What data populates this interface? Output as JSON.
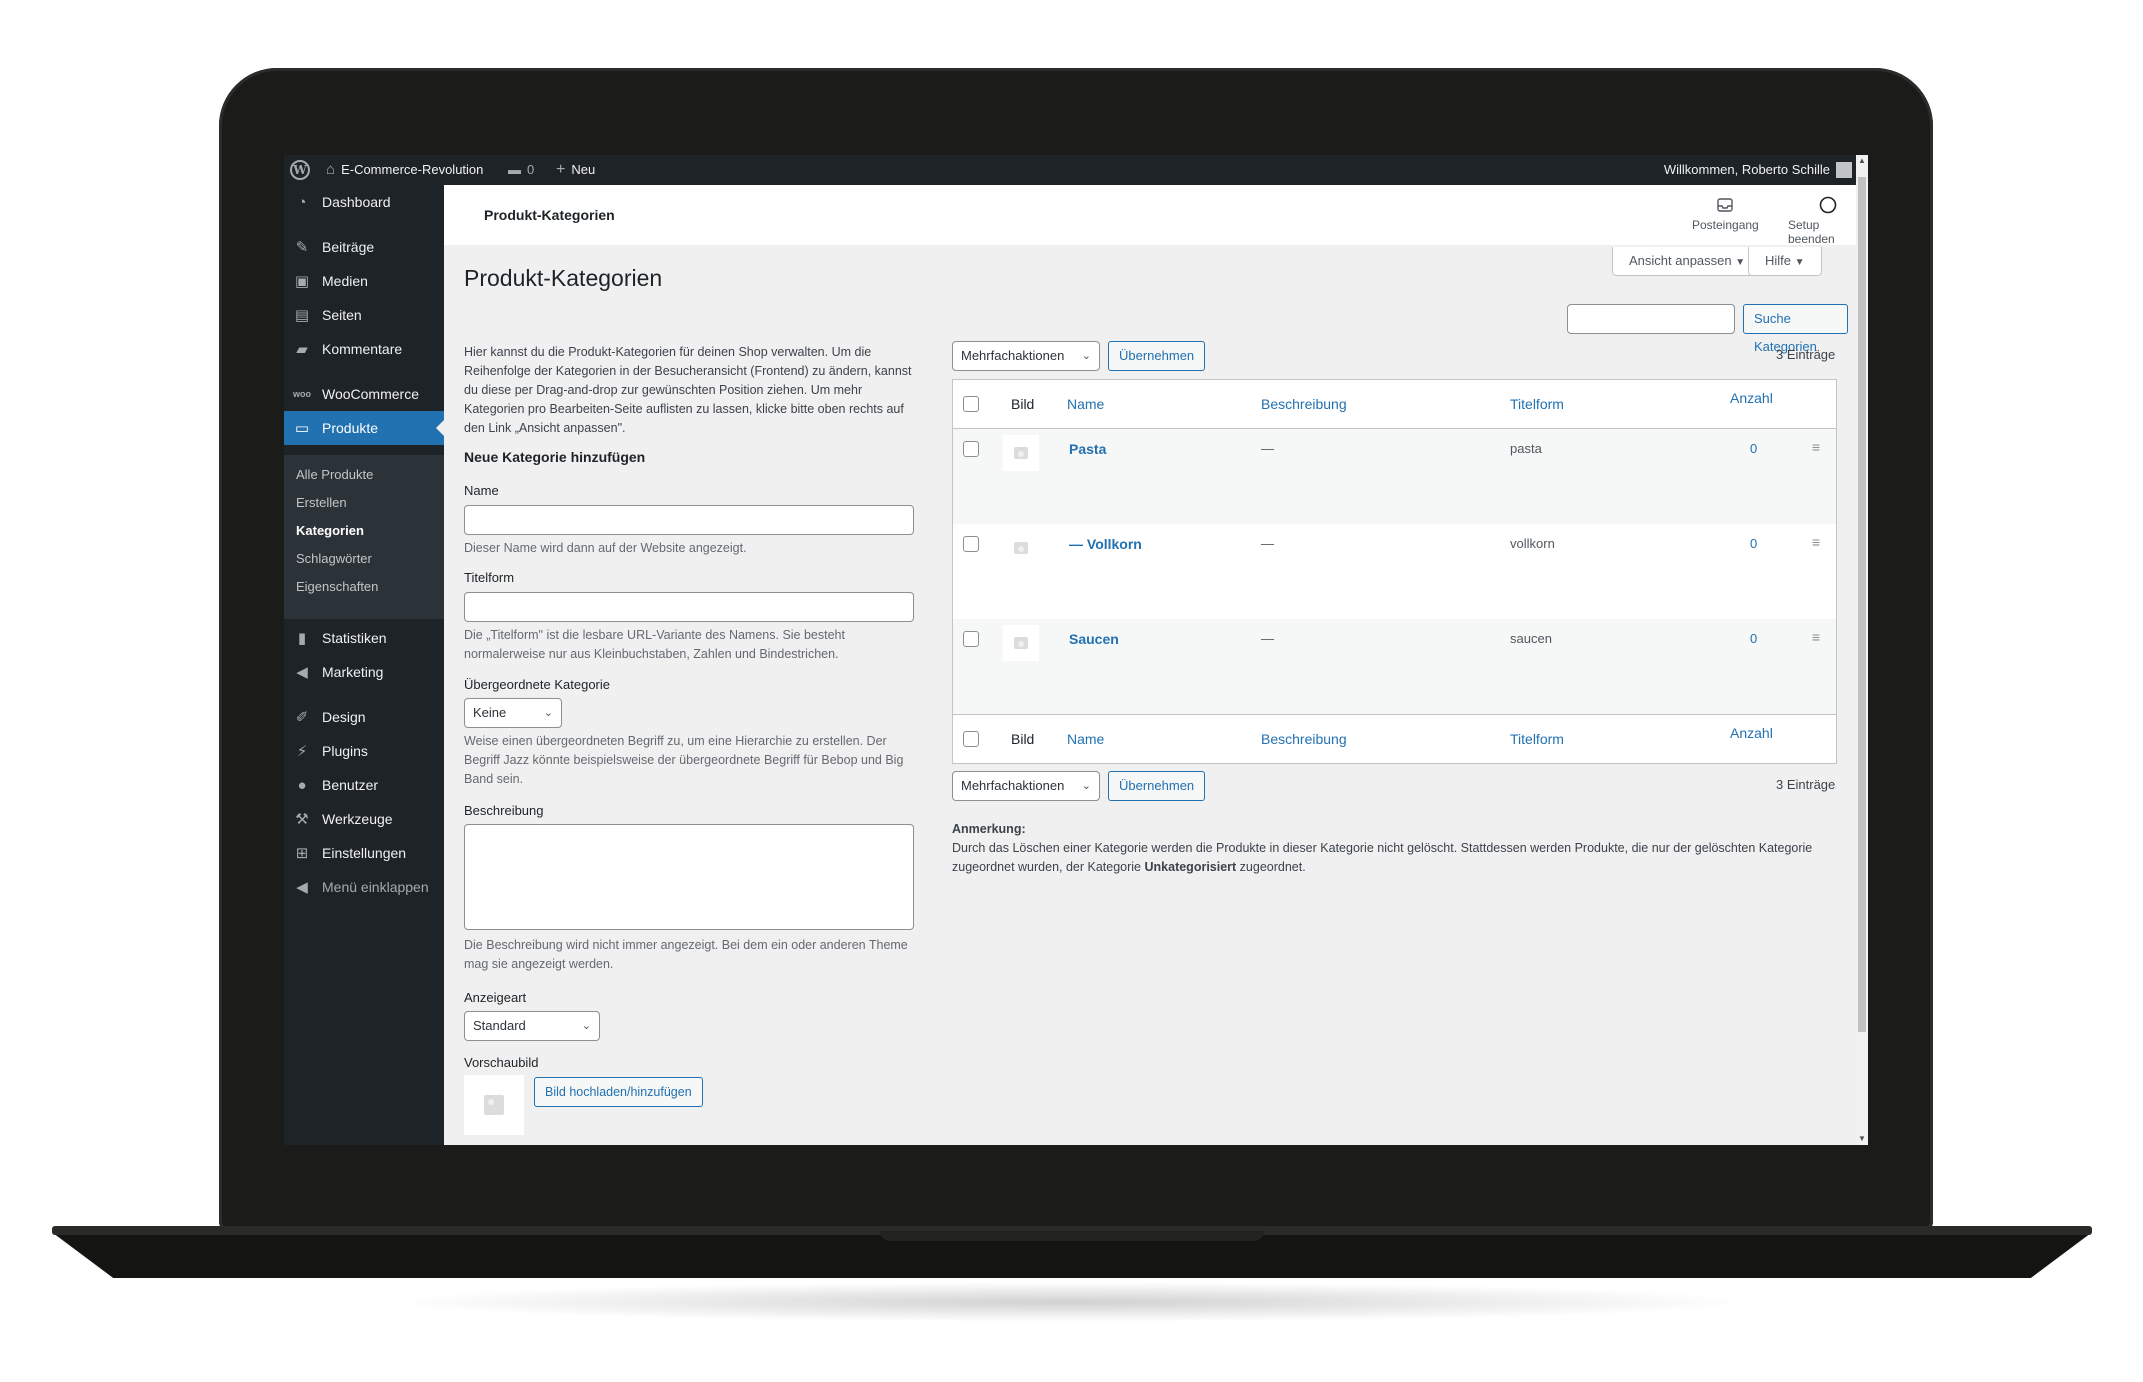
{
  "adminbar": {
    "site_name": "E-Commerce-Revolution",
    "comments_count": "0",
    "new_label": "Neu",
    "welcome": "Willkommen, Roberto Schille"
  },
  "sidebar": {
    "items": [
      {
        "label": "Dashboard",
        "icon": "dashboard-icon"
      },
      {
        "label": "Beiträge",
        "icon": "pin-icon"
      },
      {
        "label": "Medien",
        "icon": "media-icon"
      },
      {
        "label": "Seiten",
        "icon": "pages-icon"
      },
      {
        "label": "Kommentare",
        "icon": "comment-icon"
      },
      {
        "label": "WooCommerce",
        "icon": "woo-icon"
      },
      {
        "label": "Produkte",
        "icon": "archive-icon"
      },
      {
        "label": "Statistiken",
        "icon": "chart-icon"
      },
      {
        "label": "Marketing",
        "icon": "megaphone-icon"
      },
      {
        "label": "Design",
        "icon": "brush-icon"
      },
      {
        "label": "Plugins",
        "icon": "plugin-icon"
      },
      {
        "label": "Benutzer",
        "icon": "user-icon"
      },
      {
        "label": "Werkzeuge",
        "icon": "wrench-icon"
      },
      {
        "label": "Einstellungen",
        "icon": "settings-icon"
      }
    ],
    "collapse_label": "Menü einklappen",
    "submenu": [
      "Alle Produkte",
      "Erstellen",
      "Kategorien",
      "Schlagwörter",
      "Eigenschaften"
    ],
    "active_color": "#2271b1"
  },
  "wc_header": {
    "title": "Produkt-Kategorien",
    "inbox_label": "Posteingang",
    "setup_label": "Setup beenden"
  },
  "screen_options": "Ansicht anpassen",
  "help": "Hilfe",
  "page": {
    "title": "Produkt-Kategorien",
    "search_button": "Suche Kategorien",
    "intro": "Hier kannst du die Produkt-Kategorien für deinen Shop verwalten. Um die Reihenfolge der Kategorien in der Besucheransicht (Frontend) zu ändern, kannst du diese per Drag-and-drop zur gewünschten Position ziehen. Um mehr Kategorien pro Bearbeiten-Seite auflisten zu lassen, klicke bitte oben rechts auf den Link „Ansicht anpassen\".",
    "form": {
      "heading": "Neue Kategorie hinzufügen",
      "name_label": "Name",
      "name_desc": "Dieser Name wird dann auf der Website angezeigt.",
      "slug_label": "Titelform",
      "slug_desc": "Die „Titelform\" ist die lesbare URL-Variante des Namens. Sie besteht normalerweise nur aus Kleinbuchstaben, Zahlen und Bindestrichen.",
      "parent_label": "Übergeordnete Kategorie",
      "parent_value": "Keine",
      "parent_desc": "Weise einen übergeordneten Begriff zu, um eine Hierarchie zu erstellen. Der Begriff Jazz könnte beispielsweise der übergeordnete Begriff für Bebop und Big Band sein.",
      "description_label": "Beschreibung",
      "description_desc": "Die Beschreibung wird nicht immer angezeigt. Bei dem ein oder anderen Theme mag sie angezeigt werden.",
      "display_label": "Anzeigeart",
      "display_value": "Standard",
      "thumb_label": "Vorschaubild",
      "upload_button": "Bild hochladen/hinzufügen"
    },
    "bulk": {
      "select_label": "Mehrfachaktionen",
      "apply_label": "Übernehmen",
      "count": "3 Einträge"
    },
    "table": {
      "columns": [
        "Bild",
        "Name",
        "Beschreibung",
        "Titelform",
        "Anzahl"
      ],
      "rows": [
        {
          "name": "Pasta",
          "description": "—",
          "slug": "pasta",
          "count": "0"
        },
        {
          "name": "— Vollkorn",
          "description": "—",
          "slug": "vollkorn",
          "count": "0"
        },
        {
          "name": "Saucen",
          "description": "—",
          "slug": "saucen",
          "count": "0"
        }
      ]
    },
    "note": {
      "title": "Anmerkung:",
      "text_before": "Durch das Löschen einer Kategorie werden die Produkte in dieser Kategorie nicht gelöscht. Stattdessen werden Produkte, die nur der gelöschten Kategorie zugeordnet wurden, der Kategorie ",
      "bold": "Unkategorisiert",
      "text_after": " zugeordnet."
    }
  }
}
